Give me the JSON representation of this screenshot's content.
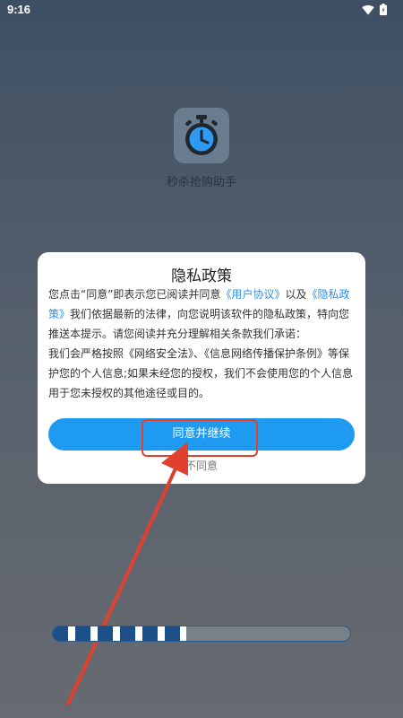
{
  "status_bar": {
    "time": "9:16",
    "icons": [
      "wifi-icon",
      "battery-icon"
    ]
  },
  "app": {
    "icon": "stopwatch-icon",
    "name": "秒杀抢购助手"
  },
  "dialog": {
    "title": "隐私政策",
    "para1_before": "您点击“同意”即表示您已阅读并同意",
    "user_agreement_link": "《用户协议》",
    "para1_and": "以及",
    "privacy_link": "《隐私政策》",
    "para1_after": "我们依据最新的法律，向您说明该软件的隐私政策，特向您推送本提示。请您阅读并充分理解相关条款我们承诺：",
    "para2": "我们会严格按照《网络安全法》、《信息网络传播保护条例》等保护您的个人信息;如果未经您的授权，我们不会使用您的个人信息用于您未授权的其他途径或目的。",
    "agree_label": "同意并继续",
    "disagree_label": "不同意"
  },
  "colors": {
    "accent": "#1e9bf0",
    "link": "#2e8fe8",
    "annotation": "#e0412f",
    "progress": "#1d4f88"
  },
  "progress": {
    "fraction": 0.45
  }
}
